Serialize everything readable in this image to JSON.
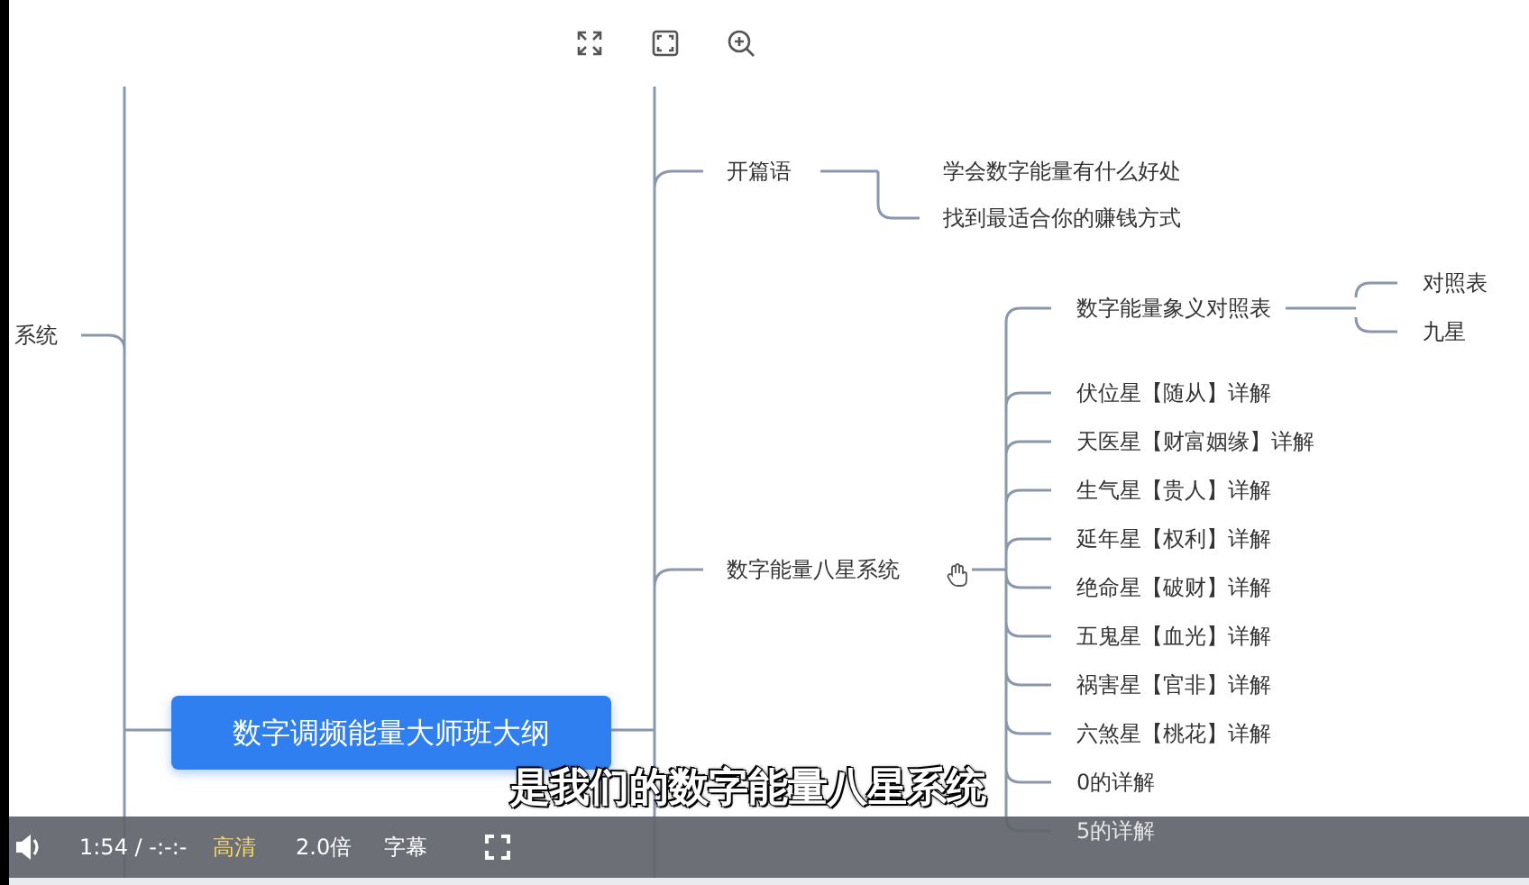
{
  "mind_map": {
    "root": "数字调频能量大师班大纲",
    "left_branches": [
      {
        "label": "系统"
      }
    ],
    "right_branches": [
      {
        "label": "开篇语",
        "children": [
          {
            "label": "学会数字能量有什么好处"
          },
          {
            "label": "找到最适合你的赚钱方式"
          }
        ]
      },
      {
        "label": "数字能量八星系统",
        "children": [
          {
            "label": "数字能量象义对照表",
            "children": [
              {
                "label": "对照表"
              },
              {
                "label": "九星"
              }
            ]
          },
          {
            "label": "伏位星【随从】详解"
          },
          {
            "label": "天医星【财富姻缘】详解"
          },
          {
            "label": "生气星【贵人】详解"
          },
          {
            "label": "延年星【权利】详解"
          },
          {
            "label": "绝命星【破财】详解"
          },
          {
            "label": "五鬼星【血光】详解"
          },
          {
            "label": "祸害星【官非】详解"
          },
          {
            "label": "六煞星【桃花】详解"
          },
          {
            "label": "0的详解"
          },
          {
            "label": "5的详解"
          }
        ]
      }
    ]
  },
  "subtitle": "是我们的数字能量八星系统",
  "player": {
    "time": "1:54 / -:-:-",
    "quality": "高清",
    "speed": "2.0倍",
    "captions": "字幕"
  }
}
